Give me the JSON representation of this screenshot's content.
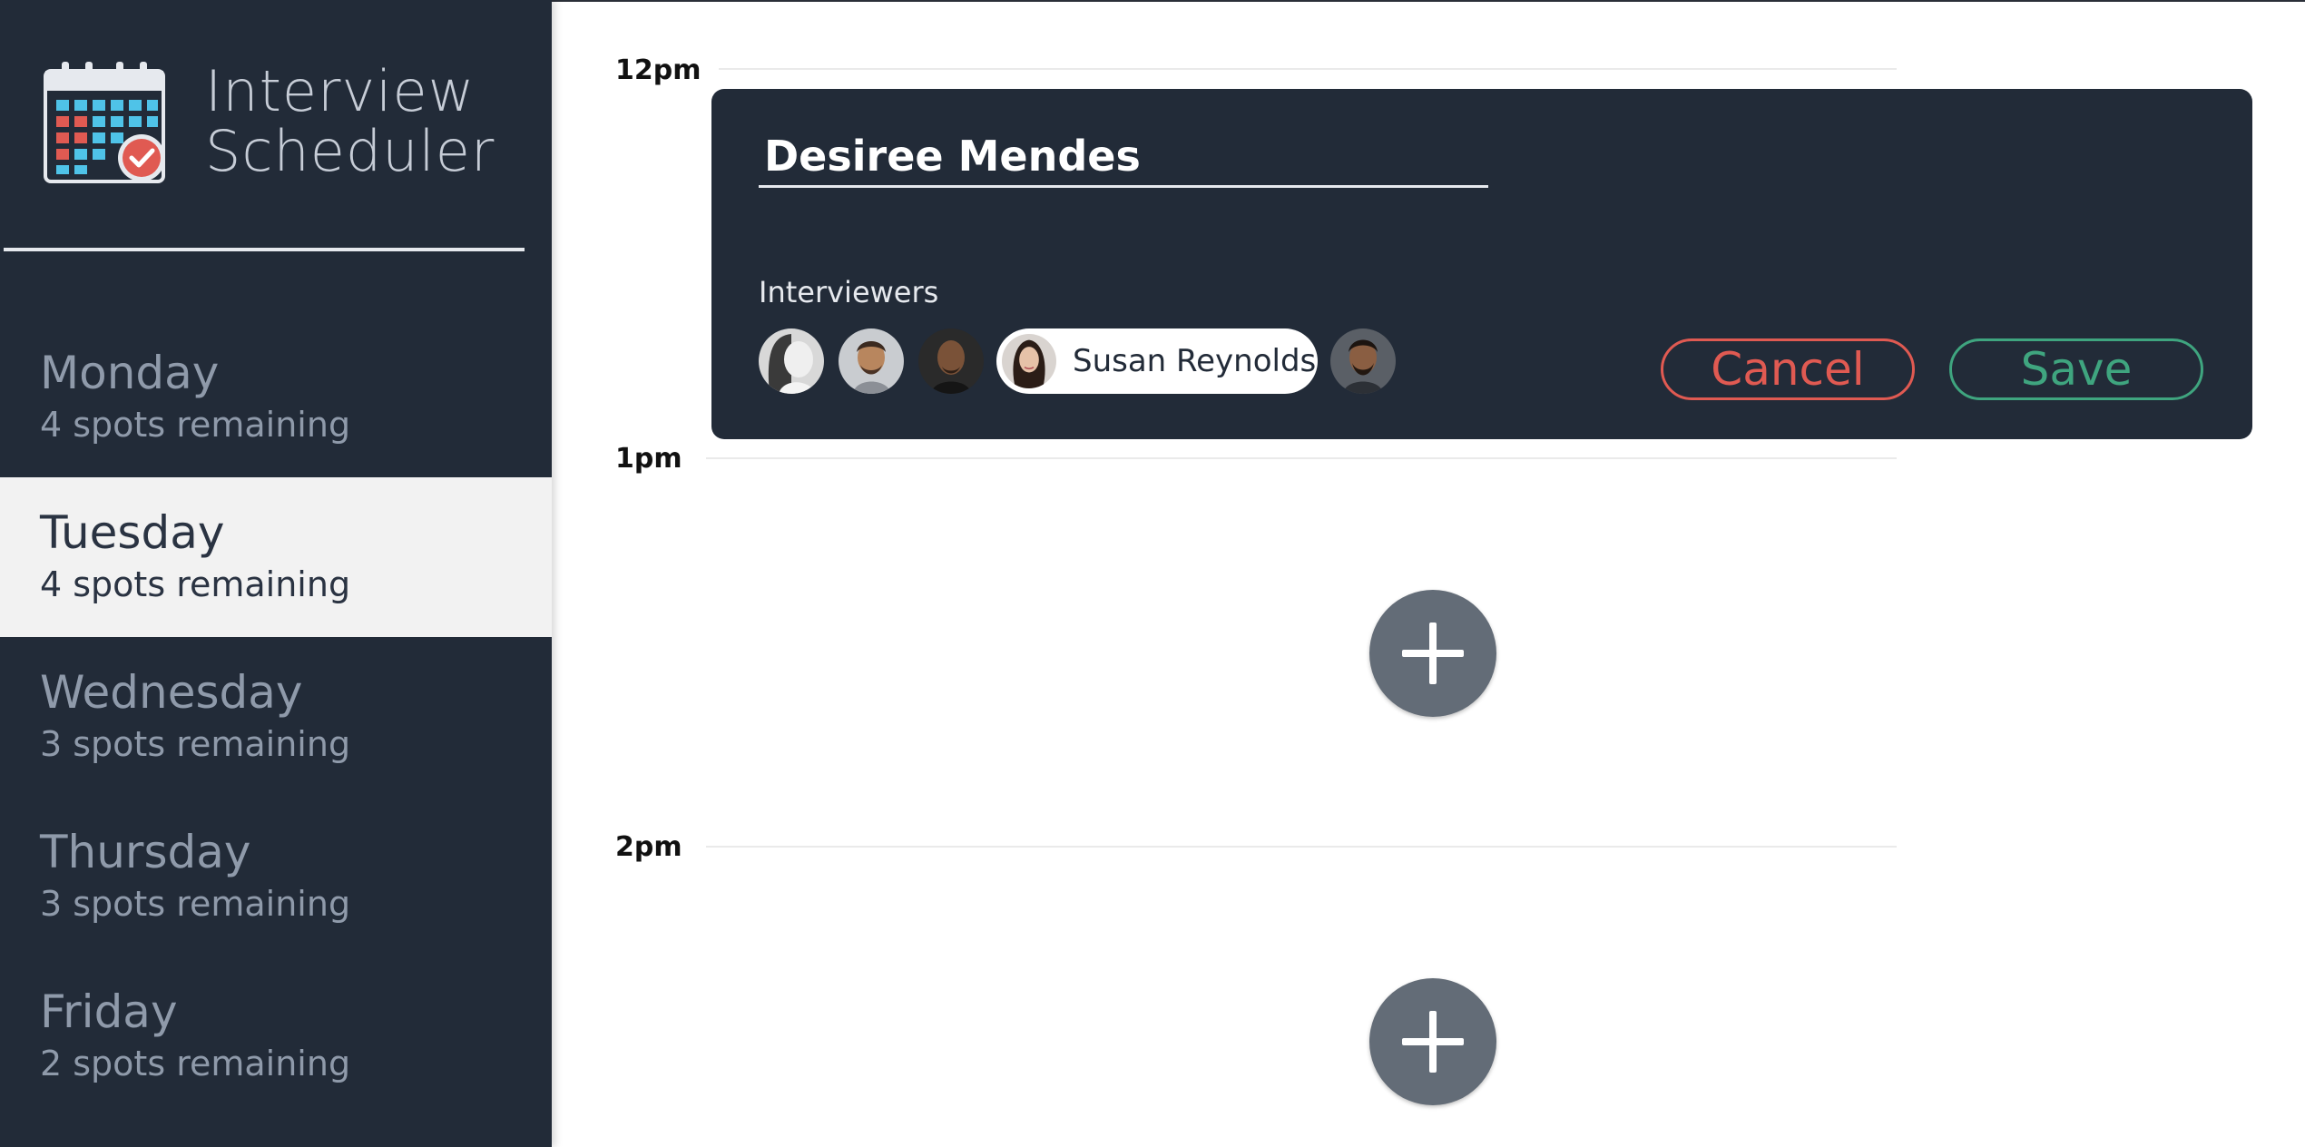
{
  "app": {
    "title_line1": "Interview",
    "title_line2": "Scheduler"
  },
  "sidebar": {
    "days": [
      {
        "name": "Monday",
        "spots": "4 spots remaining",
        "selected": false
      },
      {
        "name": "Tuesday",
        "spots": "4 spots remaining",
        "selected": true
      },
      {
        "name": "Wednesday",
        "spots": "3 spots remaining",
        "selected": false
      },
      {
        "name": "Thursday",
        "spots": "3 spots remaining",
        "selected": false
      },
      {
        "name": "Friday",
        "spots": "2 spots remaining",
        "selected": false
      }
    ]
  },
  "schedule": {
    "times": [
      "12pm",
      "1pm",
      "2pm"
    ]
  },
  "form": {
    "student_name": "Desiree Mendes",
    "interviewers_label": "Interviewers",
    "selected_interviewer": "Susan Reynolds",
    "cancel_label": "Cancel",
    "save_label": "Save"
  },
  "colors": {
    "sidebar_bg": "#222b38",
    "selected_day_bg": "#f2f2f2",
    "cancel": "#e05a52",
    "save": "#3fa57f",
    "add_button": "#636c77"
  },
  "icons": {
    "logo": "calendar-check-icon",
    "add": "plus-icon"
  }
}
